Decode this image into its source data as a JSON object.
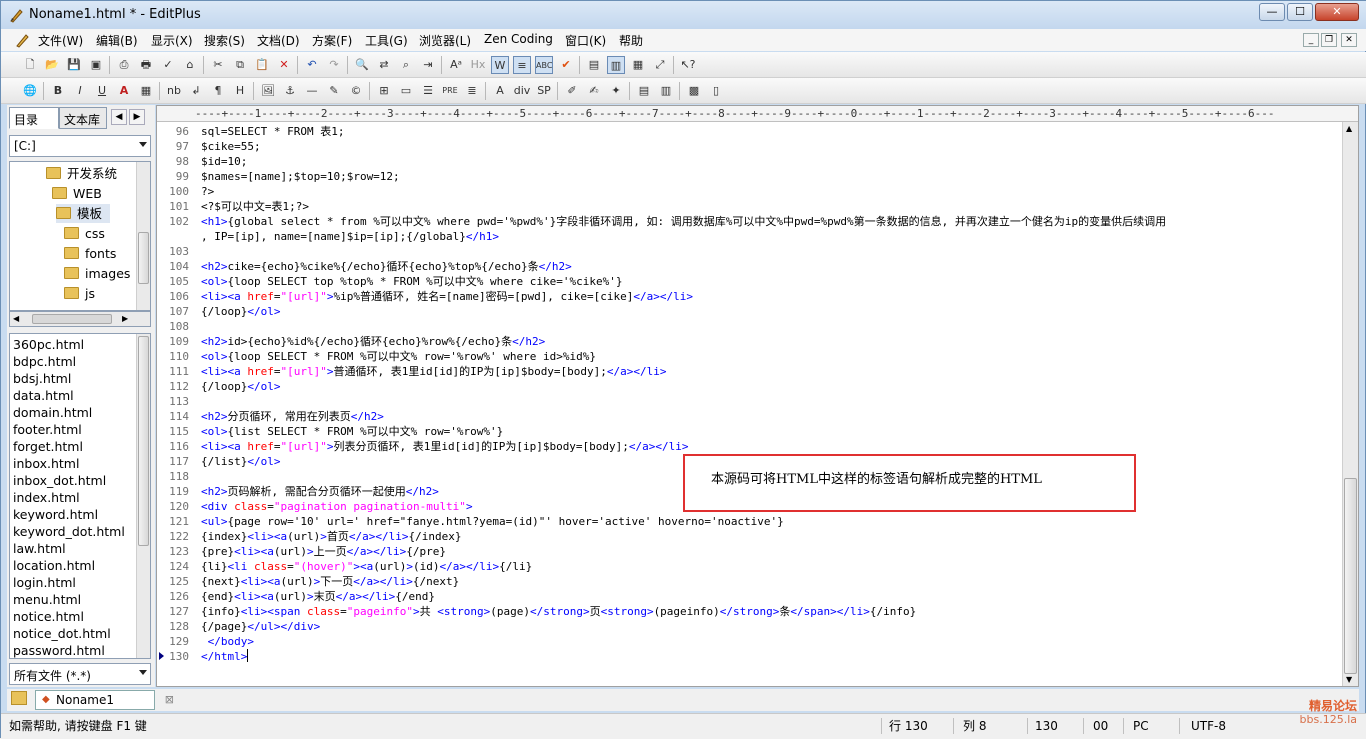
{
  "window": {
    "title": "Noname1.html * - EditPlus",
    "min": "—",
    "max": "☐",
    "close": "✕"
  },
  "menu": [
    "文件(W)",
    "编辑(B)",
    "显示(X)",
    "搜索(S)",
    "文档(D)",
    "方案(F)",
    "工具(G)",
    "浏览器(L)",
    "Zen Coding",
    "窗口(K)",
    "帮助"
  ],
  "left_panel": {
    "tabs": [
      "目录",
      "文本库"
    ],
    "drive": "[C:]",
    "tree": [
      "开发系统",
      "WEB",
      "模板",
      "css",
      "fonts",
      "images",
      "js"
    ],
    "files": [
      "360pc.html",
      "bdpc.html",
      "bdsj.html",
      "data.html",
      "domain.html",
      "footer.html",
      "forget.html",
      "inbox.html",
      "inbox_dot.html",
      "index.html",
      "keyword.html",
      "keyword_dot.html",
      "law.html",
      "location.html",
      "login.html",
      "menu.html",
      "notice.html",
      "notice_dot.html",
      "password.html"
    ],
    "filter": "所有文件 (*.*)"
  },
  "ruler": "----+----1----+----2----+----3----+----4----+----5----+----6----+----7----+----8----+----9----+----0----+----1----+----2----+----3----+----4----+----5----+----6---",
  "code_lines": [
    {
      "n": "96",
      "c": "sql=SELECT * FROM 表1;"
    },
    {
      "n": "97",
      "c": "$cike=55;"
    },
    {
      "n": "98",
      "c": "$id=10;"
    },
    {
      "n": "99",
      "c": "$names=[name];$top=10;$row=12;"
    },
    {
      "n": "100",
      "c": "?>"
    },
    {
      "n": "101",
      "c": "<?$可以中文=表1;?>"
    },
    {
      "n": "102",
      "c": "<h1>{global select * from %可以中文% where pwd='%pwd%'}字段非循环调用, 如: 调用数据库%可以中文%中pwd=%pwd%第一条数据的信息, 并再次建立一个健名为ip的变量供后续调用"
    },
    {
      "n": "",
      "c": ", IP=[ip], name=[name]$ip=[ip];{/global}</h1>"
    },
    {
      "n": "103",
      "c": ""
    },
    {
      "n": "104",
      "c": "<h2>cike={echo}%cike%{/echo}循环{echo}%top%{/echo}条</h2>"
    },
    {
      "n": "105",
      "c": "<ol>{loop SELECT top %top% * FROM %可以中文% where cike='%cike%'}"
    },
    {
      "n": "106",
      "c": "<li><a href=\"[url]\">%ip%普通循环, 姓名=[name]密码=[pwd], cike=[cike]</a></li>"
    },
    {
      "n": "107",
      "c": "{/loop}</ol>"
    },
    {
      "n": "108",
      "c": ""
    },
    {
      "n": "109",
      "c": "<h2>id>{echo}%id%{/echo}循环{echo}%row%{/echo}条</h2>"
    },
    {
      "n": "110",
      "c": "<ol>{loop SELECT * FROM %可以中文% row='%row%' where id>%id%}"
    },
    {
      "n": "111",
      "c": "<li><a href=\"[url]\">普通循环, 表1里id[id]的IP为[ip]$body=[body];</a></li>"
    },
    {
      "n": "112",
      "c": "{/loop}</ol>"
    },
    {
      "n": "113",
      "c": ""
    },
    {
      "n": "114",
      "c": "<h2>分页循环, 常用在列表页</h2>"
    },
    {
      "n": "115",
      "c": "<ol>{list SELECT * FROM %可以中文% row='%row%'}"
    },
    {
      "n": "116",
      "c": "<li><a href=\"[url]\">列表分页循环, 表1里id[id]的IP为[ip]$body=[body];</a></li>"
    },
    {
      "n": "117",
      "c": "{/list}</ol>"
    },
    {
      "n": "118",
      "c": ""
    },
    {
      "n": "119",
      "c": "<h2>页码解析, 需配合分页循环一起使用</h2>"
    },
    {
      "n": "120",
      "c": "<div class=\"pagination pagination-multi\">"
    },
    {
      "n": "121",
      "c": "<ul>{page row='10' url=' href=\"fanye.html?yema=(id)\"' hover='active' hoverno='noactive'}"
    },
    {
      "n": "122",
      "c": "{index}<li><a(url)>首页</a></li>{/index}"
    },
    {
      "n": "123",
      "c": "{pre}<li><a(url)>上一页</a></li>{/pre}"
    },
    {
      "n": "124",
      "c": "{li}<li class=\"(hover)\"><a(url)>(id)</a></li>{/li}"
    },
    {
      "n": "125",
      "c": "{next}<li><a(url)>下一页</a></li>{/next}"
    },
    {
      "n": "126",
      "c": "{end}<li><a(url)>末页</a></li>{/end}"
    },
    {
      "n": "127",
      "c": "{info}<li><span class=\"pageinfo\">共 <strong>(page)</strong>页<strong>(pageinfo)</strong>条</span></li>{/info}"
    },
    {
      "n": "128",
      "c": "{/page}</ul></div>"
    },
    {
      "n": "129",
      "c": " </body>"
    },
    {
      "n": "130",
      "c": "</html>"
    }
  ],
  "annotation": "本源码可将HTML中这样的标签语句解析成完整的HTML",
  "doc_tab": "Noname1",
  "status": {
    "help": "如需帮助, 请按键盘 F1 键",
    "line": "行 130",
    "col": "列 8",
    "count": "130",
    "num": "00",
    "mode": "PC",
    "encoding": "UTF-8"
  },
  "watermark": {
    "title": "精易论坛",
    "url": "bbs.125.la"
  },
  "colors": {
    "tag": "#0000ff",
    "attr": "#ff0000",
    "string": "#ff00ff",
    "annotation_border": "#e03030"
  }
}
